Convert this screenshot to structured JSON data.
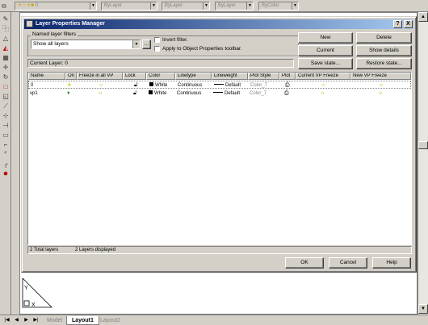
{
  "toolbar": {
    "layer_combo_value": "0",
    "color_combo": "ByLayer",
    "linetype_combo": "ByLayer",
    "lineweight_combo": "ByLayer",
    "plotstyle_combo": "ByColor"
  },
  "dialog": {
    "title": "Layer Properties Manager",
    "help_glyph": "?",
    "close_glyph": "X",
    "filters_group_label": "Named layer filters",
    "filter_select_value": "Show all layers",
    "filter_browse_label": "...",
    "invert_filter_label": "Invert filter.",
    "apply_toolbar_label": "Apply to Object Properties toolbar.",
    "current_layer_label": "Current Layer:",
    "current_layer_value": "0",
    "buttons": {
      "new": "New",
      "delete": "Delete",
      "current": "Current",
      "show_details": "Show details",
      "save_state": "Save state...",
      "restore_state": "Restore state..."
    },
    "table": {
      "columns": [
        "Name",
        "On",
        "Freeze in all VP",
        "Lock",
        "Color",
        "Linetype",
        "Lineweight",
        "Plot Style",
        "Plot",
        "Current VP Freeze",
        "New VP Freeze"
      ],
      "rows": [
        {
          "name": "0",
          "on_icon": "bulb-on-icon",
          "freeze_icon": "sun-icon",
          "lock_icon": "unlock-icon",
          "color_hex": "#000000",
          "color": "White",
          "linetype": "Continuous",
          "lineweight": "Default",
          "plot_style": "Color_7",
          "plot_icon": "printer-icon",
          "current_vp_icon": "vp-thaw-icon",
          "new_vp_icon": "vp-thaw-icon"
        },
        {
          "name": "vp1",
          "on_icon": "bulb-on-icon",
          "freeze_icon": "sun-icon",
          "lock_icon": "unlock-icon",
          "color_hex": "#000000",
          "color": "White",
          "linetype": "Continuous",
          "lineweight": "Default",
          "plot_style": "Color_7",
          "plot_icon": "printer-icon",
          "current_vp_icon": "vp-thaw-icon",
          "new_vp_icon": "vp-thaw-icon"
        }
      ]
    },
    "status": {
      "total_layers": "2 Total layers",
      "layers_displayed": "2 Layers displayed"
    },
    "footer": {
      "ok": "OK",
      "cancel": "Cancel",
      "help": "Help"
    }
  },
  "tabs": {
    "model": "Model",
    "layout1": "Layout1",
    "layout2": "Layout2"
  }
}
